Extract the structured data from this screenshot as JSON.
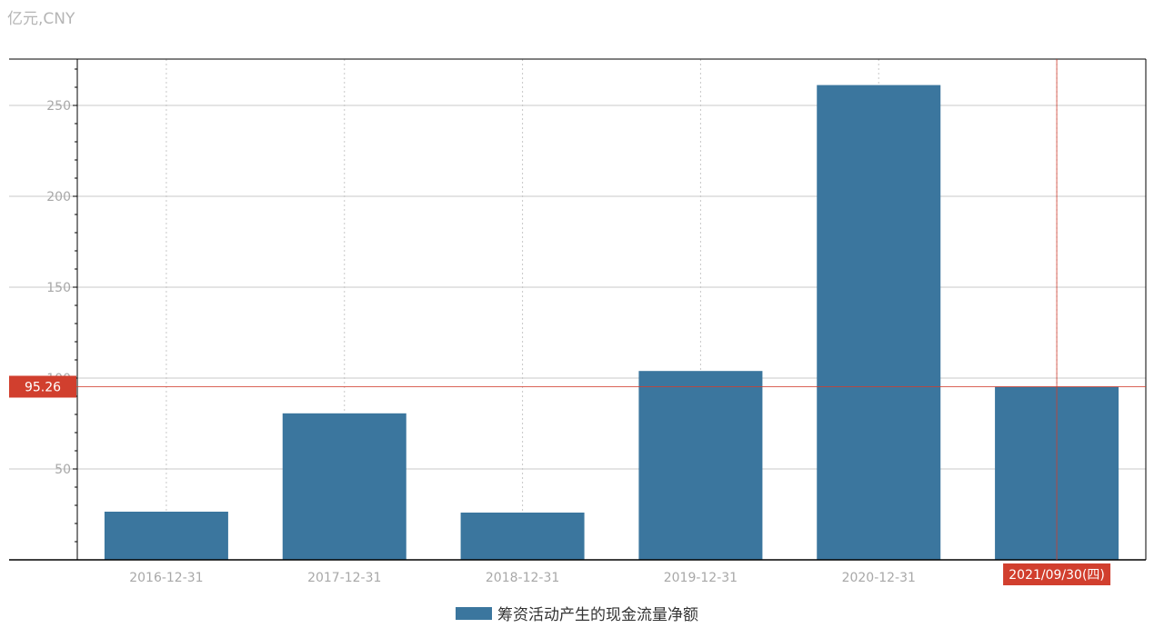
{
  "unit_label": "亿元,CNY",
  "colors": {
    "bar": "#3b769e",
    "cursor": "#d13f2e",
    "grid": "#c8c8c8",
    "axis": "#000000"
  },
  "cursor": {
    "y_value_label": "95.26",
    "x_label": "2021/09/30(四)"
  },
  "chart_data": {
    "type": "bar",
    "categories": [
      "2016-12-31",
      "2017-12-31",
      "2018-12-31",
      "2019-12-31",
      "2020-12-31",
      "2021-09-30"
    ],
    "series": [
      {
        "name": "筹资活动产生的现金流量净额",
        "values": [
          26.5,
          80.6,
          26.0,
          103.9,
          261.2,
          95.26
        ]
      }
    ],
    "x_tick_labels": [
      "2016-12-31",
      "2017-12-31",
      "2018-12-31",
      "2019-12-31",
      "2020-12-31",
      ""
    ],
    "y_ticks": [
      50,
      100,
      150,
      200,
      250
    ],
    "ylim": [
      0,
      275
    ],
    "grid": true,
    "legend_position": "bottom-center"
  }
}
